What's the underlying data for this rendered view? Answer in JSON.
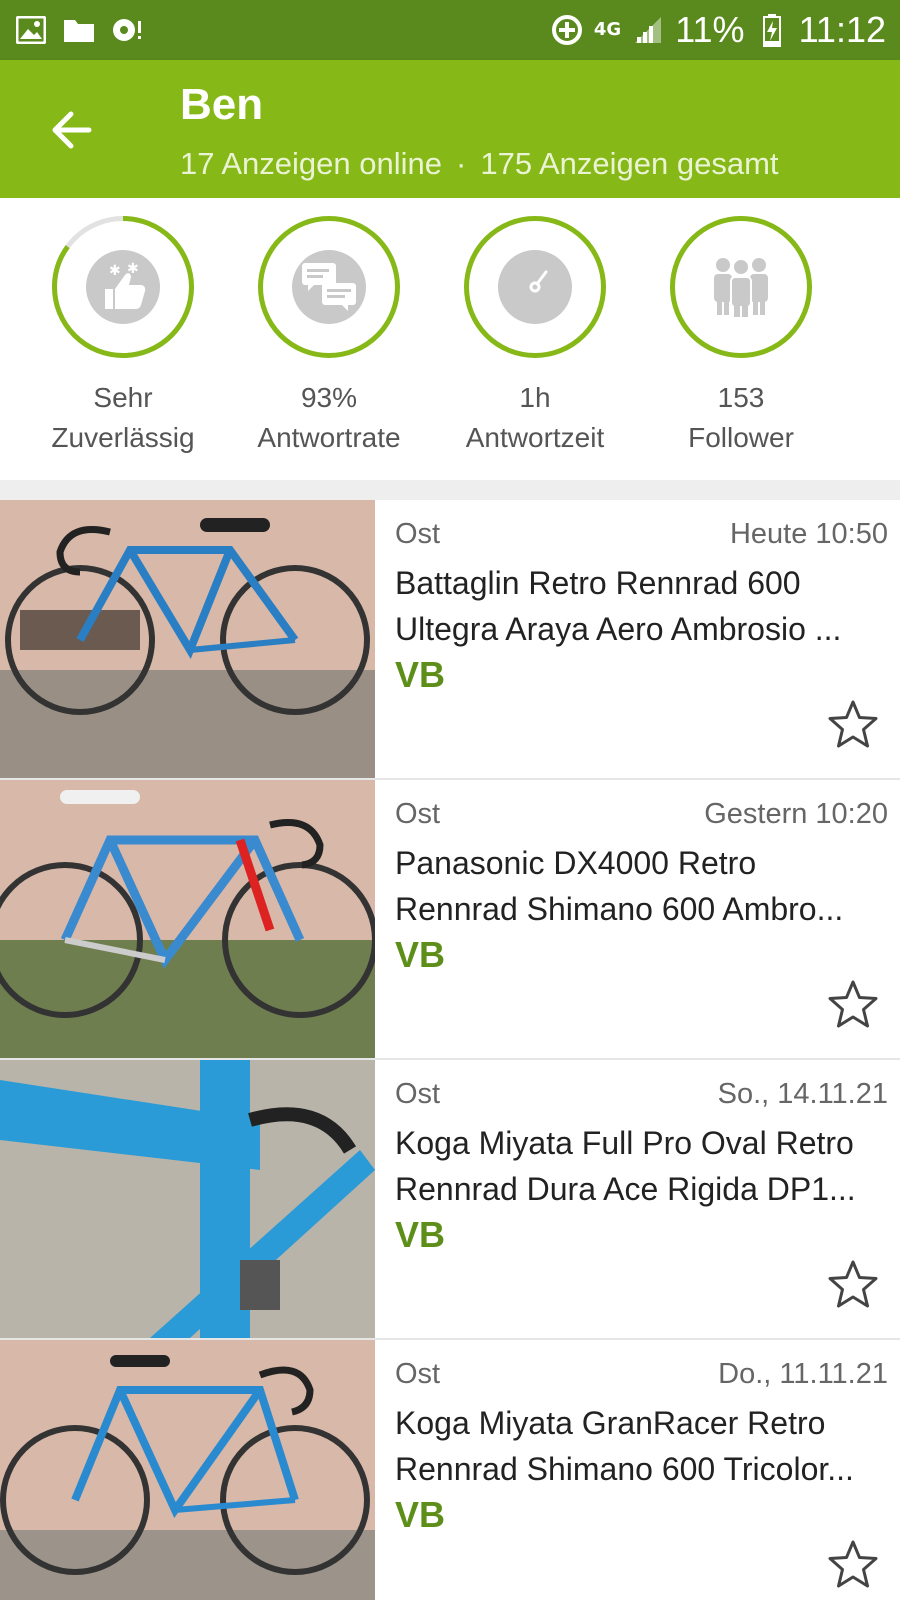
{
  "status_bar": {
    "left_icons": [
      "image-icon",
      "folder-icon",
      "notification-icon"
    ],
    "network": "4G",
    "battery": "11%",
    "time": "11:12"
  },
  "toolbar": {
    "title": "Ben",
    "ads_online": "17 Anzeigen online",
    "separator": "·",
    "ads_total": "175 Anzeigen gesamt"
  },
  "stats": [
    {
      "icon": "thumbs-up-stars-icon",
      "value": "Sehr",
      "label": "Zuverlässig",
      "progress": 0.85
    },
    {
      "icon": "chat-bubbles-icon",
      "value": "93%",
      "label": "Antwortrate",
      "progress": 1
    },
    {
      "icon": "clock-gauge-icon",
      "value": "1h",
      "label": "Antwortzeit",
      "progress": 1
    },
    {
      "icon": "people-group-icon",
      "value": "153",
      "label": "Follower",
      "progress": 1
    }
  ],
  "listings": [
    {
      "location": "Ost",
      "date": "Heute 10:50",
      "title_line1": "Battaglin Retro Rennrad 600",
      "title_line2": "Ultegra Araya Aero Ambrosio ...",
      "price": "VB"
    },
    {
      "location": "Ost",
      "date": "Gestern 10:20",
      "title_line1": "Panasonic DX4000 Retro",
      "title_line2": "Rennrad Shimano 600 Ambro...",
      "price": "VB"
    },
    {
      "location": "Ost",
      "date": "So., 14.11.21",
      "title_line1": "Koga Miyata Full Pro Oval Retro",
      "title_line2": "Rennrad Dura Ace Rigida DP1...",
      "price": "VB"
    },
    {
      "location": "Ost",
      "date": "Do., 11.11.21",
      "title_line1": "Koga Miyata GranRacer Retro",
      "title_line2": "Rennrad Shimano 600 Tricolor...",
      "price": "VB"
    }
  ],
  "colors": {
    "status_bar": "#5a8a1d",
    "toolbar": "#86b817",
    "accent_green": "#5e8e1a"
  }
}
